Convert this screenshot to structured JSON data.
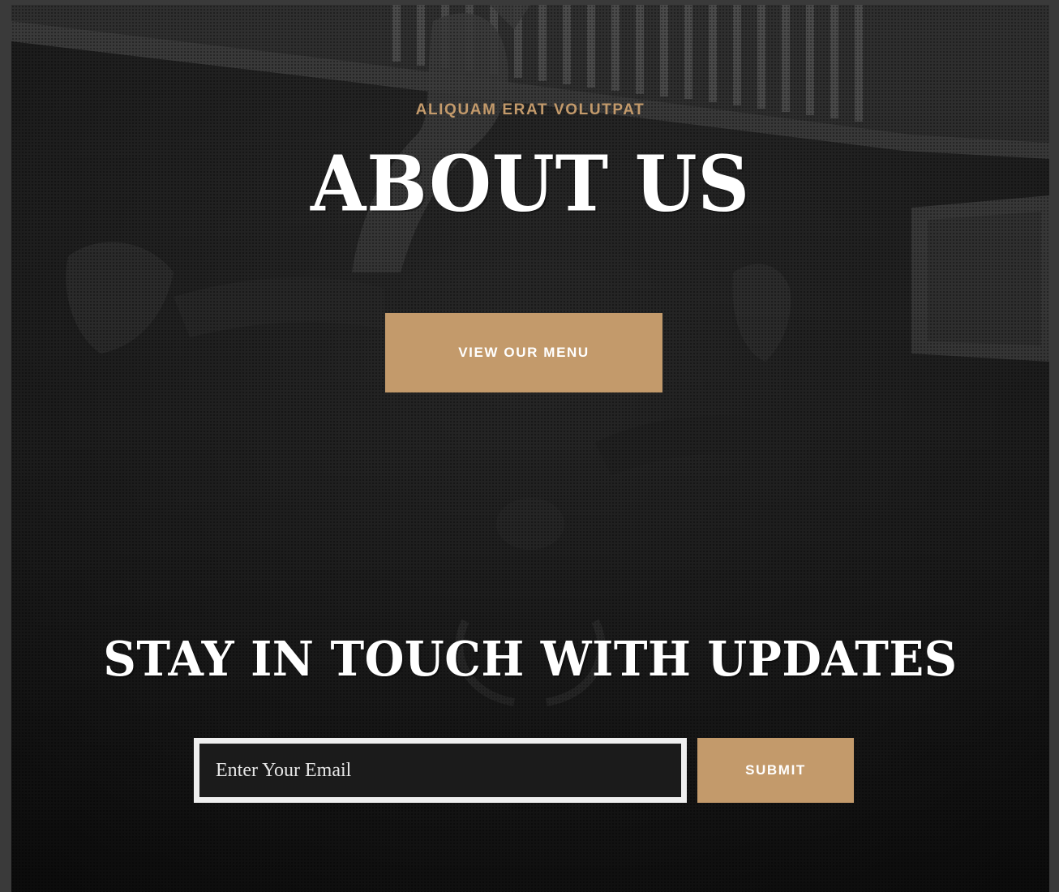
{
  "hero": {
    "eyebrow": "ALIQUAM ERAT VOLUTPAT",
    "title": "ABOUT US",
    "menu_button_label": "VIEW OUR MENU"
  },
  "newsletter": {
    "title": "STAY IN TOUCH WITH UPDATES",
    "email_placeholder": "Enter Your Email",
    "submit_label": "SUBMIT"
  },
  "colors": {
    "accent": "#c39a6b",
    "background": "#1e1e1e",
    "page_frame": "#3a3a3a",
    "text": "#ffffff"
  }
}
